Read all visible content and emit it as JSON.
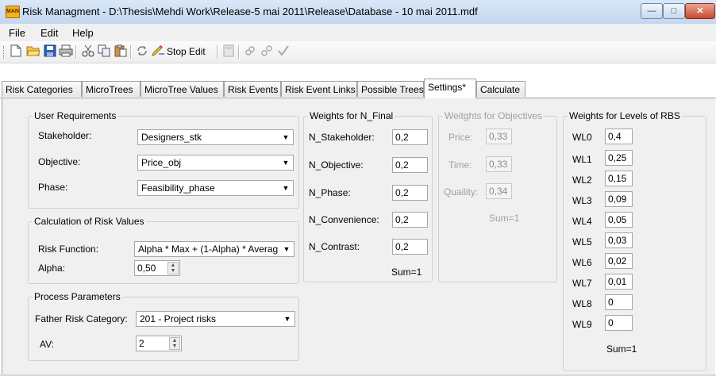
{
  "window": {
    "title": "Risk Managment - D:\\Thesis\\Mehdi Work\\Release-5 mai 2011\\Release\\Database - 10 mai 2011.mdf",
    "icon": "app-icon",
    "app_icon_text": "MAN",
    "minimize_glyph": "—",
    "maximize_glyph": "□",
    "close_glyph": "✕"
  },
  "menu": [
    "File",
    "Edit",
    "Help"
  ],
  "toolbar": {
    "icons": [
      "new-file-icon",
      "open-folder-icon",
      "save-icon",
      "print-icon",
      "cut-icon",
      "copy-icon",
      "paste-icon",
      "refresh-icon",
      "stop-edit-icon",
      "calculator-icon",
      "link-icon",
      "unlink-icon",
      "checkmark-icon"
    ],
    "stop_edit_label": "Stop Edit"
  },
  "tabs": [
    {
      "label": "Risk Categories",
      "active": false
    },
    {
      "label": "MicroTrees",
      "active": false
    },
    {
      "label": "MicroTree Values",
      "active": false
    },
    {
      "label": "Risk Events",
      "active": false
    },
    {
      "label": "Risk Event Links",
      "active": false
    },
    {
      "label": "Possible Trees",
      "active": false
    },
    {
      "label": "Settings*",
      "active": true
    },
    {
      "label": "Calculate",
      "active": false
    }
  ],
  "user_requirements": {
    "title": "User Requirements",
    "stakeholder_label": "Stakeholder:",
    "stakeholder_value": "Designers_stk",
    "objective_label": "Objective:",
    "objective_value": "Price_obj",
    "phase_label": "Phase:",
    "phase_value": "Feasibility_phase"
  },
  "calculation": {
    "title": "Calculation of Risk Values",
    "function_label": "Risk Function:",
    "function_value": "Alpha * Max + (1-Alpha) * Averag",
    "alpha_label": "Alpha:",
    "alpha_value": "0,50"
  },
  "process": {
    "title": "Process Parameters",
    "father_label": "Father Risk Category:",
    "father_value": "201 - Project risks",
    "av_label": "AV:",
    "av_value": "2"
  },
  "n_final": {
    "title": "Weights for N_Final",
    "rows": [
      {
        "label": "N_Stakeholder:",
        "value": "0,2"
      },
      {
        "label": "N_Objective:",
        "value": "0,2"
      },
      {
        "label": "N_Phase:",
        "value": "0,2"
      },
      {
        "label": "N_Convenience:",
        "value": "0,2"
      },
      {
        "label": "N_Contrast:",
        "value": "0,2"
      }
    ],
    "sum": "Sum=1"
  },
  "objectives": {
    "title": "Weitghts for Objectives",
    "rows": [
      {
        "label": "Price:",
        "value": "0,33"
      },
      {
        "label": "Time:",
        "value": "0,33"
      },
      {
        "label": "Quaility:",
        "value": "0,34"
      }
    ],
    "sum": "Sum=1"
  },
  "rbs": {
    "title": "Weights for Levels of RBS",
    "rows": [
      {
        "label": "WL0",
        "value": "0,4"
      },
      {
        "label": "WL1",
        "value": "0,25"
      },
      {
        "label": "WL2",
        "value": "0,15"
      },
      {
        "label": "WL3",
        "value": "0,09"
      },
      {
        "label": "WL4",
        "value": "0,05"
      },
      {
        "label": "WL5",
        "value": "0,03"
      },
      {
        "label": "WL6",
        "value": "0,02"
      },
      {
        "label": "WL7",
        "value": "0,01"
      },
      {
        "label": "WL8",
        "value": "0"
      },
      {
        "label": "WL9",
        "value": "0"
      }
    ],
    "sum": "Sum=1"
  },
  "glyphs": {
    "dropdown": "▼",
    "spin_up": "▲",
    "spin_down": "▼"
  }
}
